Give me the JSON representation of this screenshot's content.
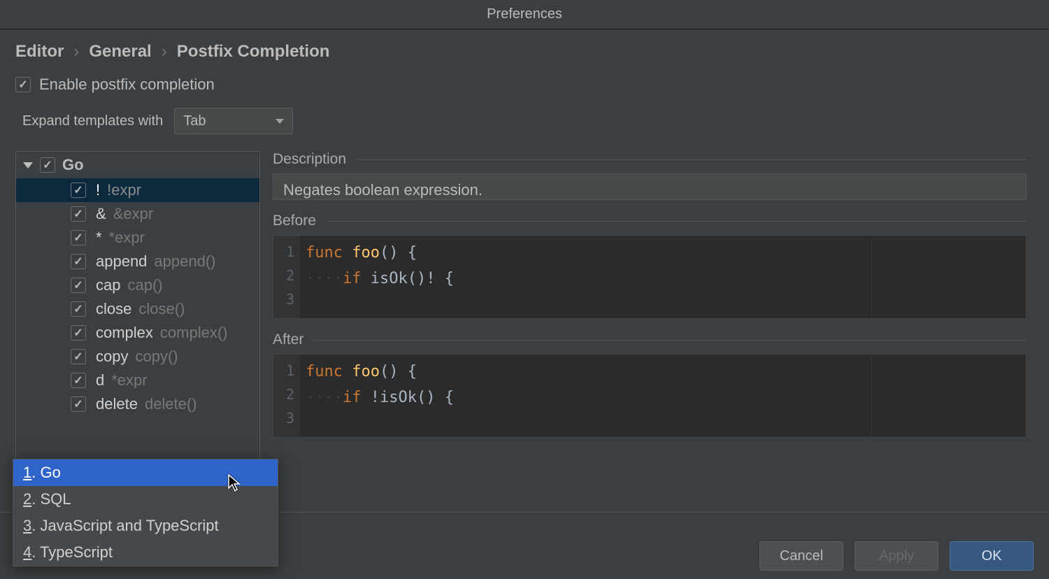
{
  "window": {
    "title": "Preferences"
  },
  "breadcrumb": {
    "p0": "Editor",
    "p1": "General",
    "p2": "Postfix Completion"
  },
  "enable": {
    "label": "Enable postfix completion",
    "checked": true
  },
  "expand": {
    "label": "Expand templates with",
    "value": "Tab"
  },
  "tree": {
    "group": "Go",
    "items": [
      {
        "key": "!",
        "hint": "!expr",
        "selected": true
      },
      {
        "key": "&",
        "hint": "&expr",
        "selected": false
      },
      {
        "key": "*",
        "hint": "*expr",
        "selected": false
      },
      {
        "key": "append",
        "hint": "append()",
        "selected": false
      },
      {
        "key": "cap",
        "hint": "cap()",
        "selected": false
      },
      {
        "key": "close",
        "hint": "close()",
        "selected": false
      },
      {
        "key": "complex",
        "hint": "complex()",
        "selected": false
      },
      {
        "key": "copy",
        "hint": "copy()",
        "selected": false
      },
      {
        "key": "d",
        "hint": "*expr",
        "selected": false
      },
      {
        "key": "delete",
        "hint": "delete()",
        "selected": false
      }
    ]
  },
  "details": {
    "description_label": "Description",
    "description_text": "Negates boolean expression.",
    "before_label": "Before",
    "after_label": "After",
    "before_code": {
      "l1_kw": "func",
      "l1_ident": "foo",
      "l1_rest": "() {",
      "l2_kw": "if",
      "l2_rest": "isOk()! {"
    },
    "after_code": {
      "l1_kw": "func",
      "l1_ident": "foo",
      "l1_rest": "() {",
      "l2_kw": "if",
      "l2_rest": "!isOk() {"
    }
  },
  "buttons": {
    "cancel": "Cancel",
    "apply": "Apply",
    "ok": "OK"
  },
  "popup": {
    "items": [
      {
        "n": "1",
        "label": "Go",
        "selected": true
      },
      {
        "n": "2",
        "label": "SQL",
        "selected": false
      },
      {
        "n": "3",
        "label": "JavaScript and TypeScript",
        "selected": false
      },
      {
        "n": "4",
        "label": "TypeScript",
        "selected": false
      }
    ]
  }
}
